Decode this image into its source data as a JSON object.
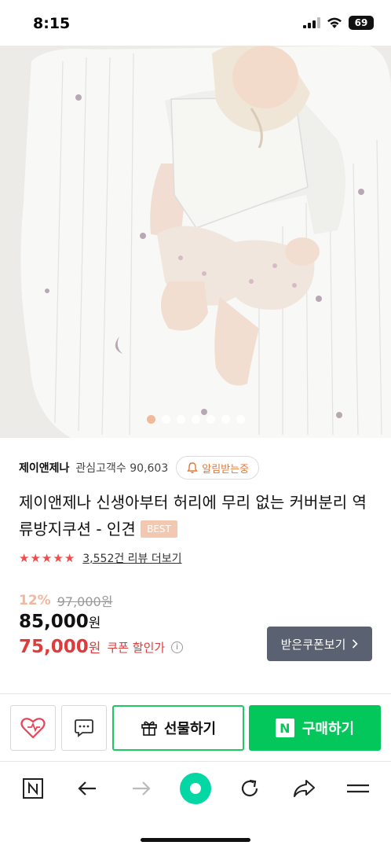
{
  "status_bar": {
    "time": "8:15",
    "battery": "69"
  },
  "carousel": {
    "total": 7,
    "active_index": 0
  },
  "brand": {
    "name": "제이앤제나",
    "interest_label": "관심고객수 90,603",
    "alarm_label": "알림받는중"
  },
  "product": {
    "title": "제이앤제나 신생아부터 허리에 무리 없는 커버분리 역류방지쿠션 - 인견",
    "badge": "BEST",
    "rating_stars": 5,
    "review_link": "3,552건 리뷰 더보기"
  },
  "price": {
    "discount_rate": "12%",
    "original": "97,000원",
    "current_value": "85,000",
    "current_unit": "원",
    "coupon_value": "75,000",
    "coupon_unit": "원",
    "coupon_label": "쿠폰 할인가",
    "coupon_button": "받은쿠폰보기"
  },
  "actions": {
    "gift_label": "선물하기",
    "buy_label": "구매하기",
    "buy_badge": "N"
  },
  "bottom_nav": {
    "items": [
      "naver-n-icon",
      "back-arrow-icon",
      "forward-arrow-icon",
      "green-dot-icon",
      "refresh-icon",
      "share-icon",
      "menu-icon"
    ]
  },
  "colors": {
    "accent_green": "#03c75a",
    "coupon_red": "#e03b3b",
    "star_red": "#f04c4c",
    "badge_peach": "#f4c8b0"
  }
}
